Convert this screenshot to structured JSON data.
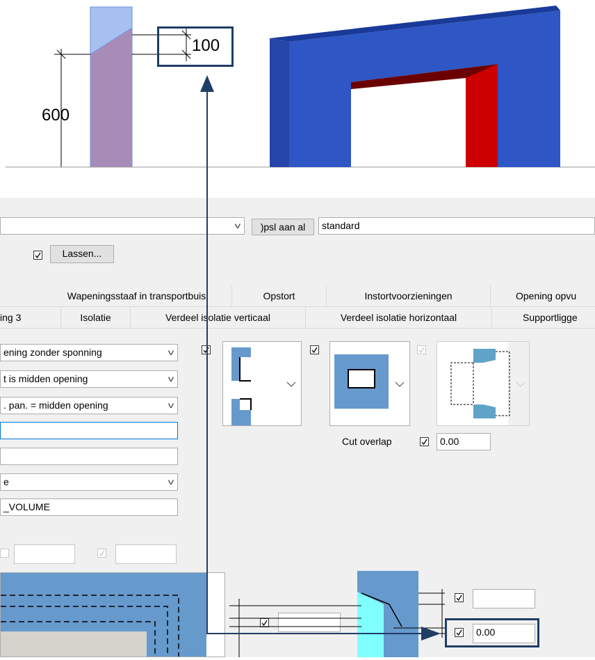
{
  "top": {
    "dim_top": "100",
    "dim_left": "600"
  },
  "dialog": {
    "preset_save_label": ")psl aan al",
    "preset_name": "standard",
    "lassen_label": "Lassen...",
    "tabs_row1": [
      "Wapeningsstaaf in transportbuis",
      "Opstort",
      "Instortvoorzieningen",
      "Opening opvu"
    ],
    "tabs_row2": [
      "ing 3",
      "Isolatie",
      "Verdeel isolatie verticaal",
      "Verdeel isolatie horizontaal",
      "Supportligge"
    ],
    "fields": {
      "opening_type": "ening zonder sponning",
      "center": "t is midden opening",
      "panel": ". pan. = midden opening",
      "field4": "",
      "field5": "",
      "field6": "e",
      "volume": "_VOLUME"
    },
    "cut_overlap_label": "Cut overlap",
    "cut_overlap_value": "0.00",
    "lower_right_value1": "",
    "lower_right_value2": "0.00",
    "lower_mid_value": "",
    "lower_left_value1": "",
    "lower_left_value2": ""
  },
  "colors": {
    "accent_box": "#1f3d66",
    "wall_blue": "#2e56c4",
    "opening_red": "#cc0000",
    "mauve": "#a88cb8",
    "light_blue": "#a8c0f0",
    "panel_blue": "#6699cc",
    "cyan": "#80ffff"
  }
}
